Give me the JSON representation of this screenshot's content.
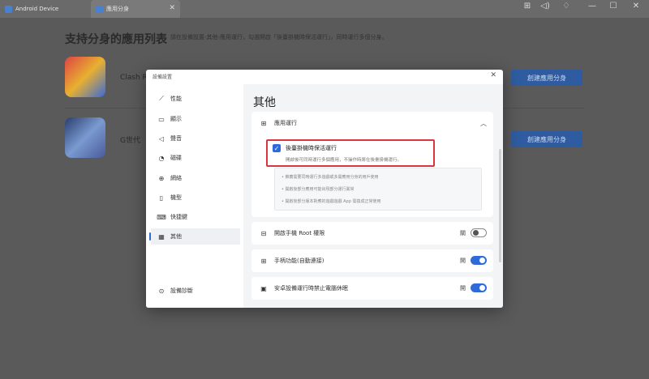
{
  "tabs": [
    {
      "label": "Android Device"
    },
    {
      "label": "應用分身"
    }
  ],
  "window_controls": [
    "⊞",
    "◁)",
    "♢",
    "—",
    "☐",
    "✕"
  ],
  "page": {
    "title": "支持分身的應用列表",
    "subtitle": "請在設備設置-其他-應用運行，勾選開啟「後臺掛機時保活運行」，同時運行多個分身。",
    "apps": [
      {
        "name": "Clash R",
        "button": "創建應用分身"
      },
      {
        "name": "G世代",
        "button": "創建應用分身"
      }
    ]
  },
  "dialog": {
    "title": "設備設置",
    "close": "✕",
    "sidebar": [
      {
        "label": "性能",
        "icon": "performance-icon",
        "glyph": "⟋"
      },
      {
        "label": "顯示",
        "icon": "display-icon",
        "glyph": "▭"
      },
      {
        "label": "聲音",
        "icon": "sound-icon",
        "glyph": "◁"
      },
      {
        "label": "磁碟",
        "icon": "disk-icon",
        "glyph": "◔"
      },
      {
        "label": "網絡",
        "icon": "network-icon",
        "glyph": "⊕"
      },
      {
        "label": "機型",
        "icon": "phone-icon",
        "glyph": "▯"
      },
      {
        "label": "快捷鍵",
        "icon": "keyboard-icon",
        "glyph": "⌨"
      },
      {
        "label": "其他",
        "icon": "grid-icon",
        "glyph": "▦"
      }
    ],
    "diagnostics": {
      "label": "設備診斷",
      "glyph": "⊙"
    },
    "content_title": "其他",
    "app_run": {
      "section_label": "應用運行",
      "checkbox_label": "後臺掛機時保活運行",
      "checkbox_desc": "開啟後可同時運行多個應用，不操作時將在後臺掛機運行。",
      "checked": true,
      "info_lines": [
        "• 推薦需要同時運行多遊戲或多開應用分身的用戶使用",
        "• 開啟後部分應用可能出現部分運行異常",
        "• 開啟後部分版本對應的遊戲遊戲 App 需換成正常使用"
      ]
    },
    "settings": [
      {
        "label": "開啟手機 Root 權限",
        "state_label": "關",
        "on": false,
        "icon": "root-icon",
        "glyph": "⊟"
      },
      {
        "label": "手柄功能(自動連接)",
        "state_label": "開",
        "on": true,
        "icon": "gamepad-icon",
        "glyph": "⊞"
      },
      {
        "label": "安卓設備運行時禁止電腦休眠",
        "state_label": "開",
        "on": true,
        "icon": "monitor-icon",
        "glyph": "▣"
      }
    ]
  }
}
